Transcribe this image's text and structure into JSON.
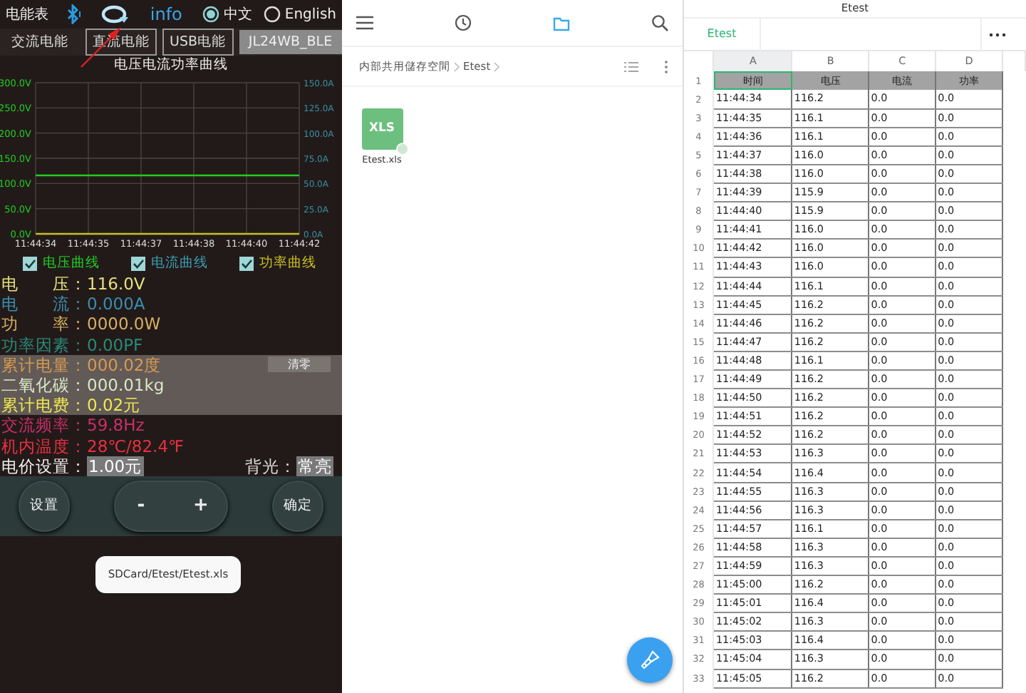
{
  "meter_app": {
    "title": "电能表",
    "info_label": "info",
    "languages": [
      {
        "label": "中文",
        "selected": true
      },
      {
        "label": "English",
        "selected": false
      }
    ],
    "tabs": [
      {
        "label": "交流电能",
        "selected": true
      },
      {
        "label": "直流电能",
        "selected": false
      },
      {
        "label": "USB电能",
        "selected": false
      }
    ],
    "device_name": "JL24WB_BLE",
    "chart": {
      "right_axis_labels": [
        "150.0A",
        "125.0A",
        "100.0A",
        "75.0A",
        "50.0A",
        "25.0A",
        "0.0A"
      ],
      "chart_data": {
        "type": "line",
        "title": "电压电流功率曲线",
        "grid": true,
        "categories": [
          "11:44:34",
          "11:44:35",
          "11:44:37",
          "11:44:38",
          "11:44:40",
          "11:44:42"
        ],
        "ylim": [
          0,
          300
        ],
        "yticks": [
          {
            "value": 0,
            "label": "0.0V"
          },
          {
            "value": 50,
            "label": "50.0V"
          },
          {
            "value": 100,
            "label": "100.0V"
          },
          {
            "value": 150,
            "label": "150.0V"
          },
          {
            "value": 200,
            "label": "200.0V"
          },
          {
            "value": 250,
            "label": "250.0V"
          },
          {
            "value": 300,
            "label": "300.0V"
          }
        ],
        "series": [
          {
            "name": "电压曲线",
            "color": "#22cc22",
            "values": [
              116,
              116,
              116,
              116,
              116,
              116
            ]
          },
          {
            "name": "电流曲线",
            "color": "#3a9fb0",
            "values": [
              null,
              null,
              null,
              null,
              null,
              null
            ]
          },
          {
            "name": "功率曲线",
            "color": "#c8c020",
            "values": [
              0,
              0,
              0,
              0,
              0,
              0
            ]
          }
        ]
      }
    },
    "legend": [
      {
        "checked": true
      },
      {
        "checked": true
      },
      {
        "checked": true
      }
    ],
    "readings": [
      {
        "label": "电　　压：",
        "value": "116.0V",
        "color": "#e6e07a",
        "highlighted": false
      },
      {
        "label": "电　　流：",
        "value": "0.000A",
        "color": "#3a8fb0",
        "highlighted": false
      },
      {
        "label": "功　　率：",
        "value": "0000.0W",
        "color": "#d8b060",
        "highlighted": false
      },
      {
        "label": "功率因素：",
        "value": "0.00PF",
        "color": "#2a8a78",
        "highlighted": false
      },
      {
        "label": "累计电量：",
        "value": "000.02度",
        "color": "#d89a50",
        "highlighted": true,
        "button": "清零"
      },
      {
        "label": "二氧化碳：",
        "value": "000.01kg",
        "color": "#d8e8c8",
        "highlighted": true
      },
      {
        "label": "累计电费：",
        "value": "0.02元",
        "color": "#f0e850",
        "highlighted": true
      },
      {
        "label": "交流频率：",
        "value": "59.8Hz",
        "color": "#c8306a",
        "highlighted": false
      },
      {
        "label": "机内温度：",
        "value": "28℃/82.4℉",
        "color": "#e83040",
        "highlighted": false
      }
    ],
    "price_setting": {
      "label": "电价设置：",
      "value": "1.00元"
    },
    "backlight": {
      "label": "背光：",
      "value": "常亮"
    },
    "controls": {
      "settings": "设置",
      "minus": "-",
      "plus": "+",
      "confirm": "确定"
    },
    "toast": "SDCard/Etest/Etest.xls"
  },
  "file_manager": {
    "nav": [
      {
        "kind": "menu",
        "selected": false
      },
      {
        "kind": "recent",
        "selected": false
      },
      {
        "kind": "folder",
        "selected": true
      },
      {
        "kind": "search",
        "selected": false
      }
    ],
    "breadcrumb": [
      "内部共用儲存空間",
      "Etest"
    ],
    "files": [
      {
        "type_label": "XLS",
        "name": "Etest.xls"
      }
    ]
  },
  "spreadsheet": {
    "title": "Etest",
    "sheet_tab": "Etest",
    "columns": [
      {
        "label": "A",
        "selected": true
      },
      {
        "label": "B",
        "selected": false
      },
      {
        "label": "C",
        "selected": false
      },
      {
        "label": "D",
        "selected": false
      }
    ],
    "rows": [
      {
        "number": "1",
        "kind": "header",
        "selected": true,
        "cells": [
          "时间",
          "电压",
          "电流",
          "功率"
        ]
      },
      {
        "number": "2",
        "kind": "data",
        "selected": false,
        "cells": [
          "11:44:34",
          "116.2",
          "0.0",
          "0.0"
        ]
      },
      {
        "number": "3",
        "kind": "data",
        "selected": false,
        "cells": [
          "11:44:35",
          "116.1",
          "0.0",
          "0.0"
        ]
      },
      {
        "number": "4",
        "kind": "data",
        "selected": false,
        "cells": [
          "11:44:36",
          "116.1",
          "0.0",
          "0.0"
        ]
      },
      {
        "number": "5",
        "kind": "data",
        "selected": false,
        "cells": [
          "11:44:37",
          "116.0",
          "0.0",
          "0.0"
        ]
      },
      {
        "number": "6",
        "kind": "data",
        "selected": false,
        "cells": [
          "11:44:38",
          "116.0",
          "0.0",
          "0.0"
        ]
      },
      {
        "number": "7",
        "kind": "data",
        "selected": false,
        "cells": [
          "11:44:39",
          "115.9",
          "0.0",
          "0.0"
        ]
      },
      {
        "number": "8",
        "kind": "data",
        "selected": false,
        "cells": [
          "11:44:40",
          "115.9",
          "0.0",
          "0.0"
        ]
      },
      {
        "number": "9",
        "kind": "data",
        "selected": false,
        "cells": [
          "11:44:41",
          "116.0",
          "0.0",
          "0.0"
        ]
      },
      {
        "number": "10",
        "kind": "data",
        "selected": false,
        "cells": [
          "11:44:42",
          "116.0",
          "0.0",
          "0.0"
        ]
      },
      {
        "number": "11",
        "kind": "data",
        "selected": false,
        "cells": [
          "11:44:43",
          "116.0",
          "0.0",
          "0.0"
        ]
      },
      {
        "number": "12",
        "kind": "data",
        "selected": false,
        "cells": [
          "11:44:44",
          "116.1",
          "0.0",
          "0.0"
        ]
      },
      {
        "number": "13",
        "kind": "data",
        "selected": false,
        "cells": [
          "11:44:45",
          "116.2",
          "0.0",
          "0.0"
        ]
      },
      {
        "number": "14",
        "kind": "data",
        "selected": false,
        "cells": [
          "11:44:46",
          "116.2",
          "0.0",
          "0.0"
        ]
      },
      {
        "number": "15",
        "kind": "data",
        "selected": false,
        "cells": [
          "11:44:47",
          "116.2",
          "0.0",
          "0.0"
        ]
      },
      {
        "number": "16",
        "kind": "data",
        "selected": false,
        "cells": [
          "11:44:48",
          "116.1",
          "0.0",
          "0.0"
        ]
      },
      {
        "number": "17",
        "kind": "data",
        "selected": false,
        "cells": [
          "11:44:49",
          "116.2",
          "0.0",
          "0.0"
        ]
      },
      {
        "number": "18",
        "kind": "data",
        "selected": false,
        "cells": [
          "11:44:50",
          "116.2",
          "0.0",
          "0.0"
        ]
      },
      {
        "number": "19",
        "kind": "data",
        "selected": false,
        "cells": [
          "11:44:51",
          "116.2",
          "0.0",
          "0.0"
        ]
      },
      {
        "number": "20",
        "kind": "data",
        "selected": false,
        "cells": [
          "11:44:52",
          "116.2",
          "0.0",
          "0.0"
        ]
      },
      {
        "number": "21",
        "kind": "data",
        "selected": false,
        "cells": [
          "11:44:53",
          "116.3",
          "0.0",
          "0.0"
        ]
      },
      {
        "number": "22",
        "kind": "data",
        "selected": false,
        "cells": [
          "11:44:54",
          "116.4",
          "0.0",
          "0.0"
        ]
      },
      {
        "number": "23",
        "kind": "data",
        "selected": false,
        "cells": [
          "11:44:55",
          "116.3",
          "0.0",
          "0.0"
        ]
      },
      {
        "number": "24",
        "kind": "data",
        "selected": false,
        "cells": [
          "11:44:56",
          "116.3",
          "0.0",
          "0.0"
        ]
      },
      {
        "number": "25",
        "kind": "data",
        "selected": false,
        "cells": [
          "11:44:57",
          "116.1",
          "0.0",
          "0.0"
        ]
      },
      {
        "number": "26",
        "kind": "data",
        "selected": false,
        "cells": [
          "11:44:58",
          "116.3",
          "0.0",
          "0.0"
        ]
      },
      {
        "number": "27",
        "kind": "data",
        "selected": false,
        "cells": [
          "11:44:59",
          "116.3",
          "0.0",
          "0.0"
        ]
      },
      {
        "number": "28",
        "kind": "data",
        "selected": false,
        "cells": [
          "11:45:00",
          "116.2",
          "0.0",
          "0.0"
        ]
      },
      {
        "number": "29",
        "kind": "data",
        "selected": false,
        "cells": [
          "11:45:01",
          "116.4",
          "0.0",
          "0.0"
        ]
      },
      {
        "number": "30",
        "kind": "data",
        "selected": false,
        "cells": [
          "11:45:02",
          "116.3",
          "0.0",
          "0.0"
        ]
      },
      {
        "number": "31",
        "kind": "data",
        "selected": false,
        "cells": [
          "11:45:03",
          "116.4",
          "0.0",
          "0.0"
        ]
      },
      {
        "number": "32",
        "kind": "data",
        "selected": false,
        "cells": [
          "11:45:04",
          "116.3",
          "0.0",
          "0.0"
        ]
      },
      {
        "number": "33",
        "kind": "data",
        "selected": false,
        "cells": [
          "11:45:05",
          "116.2",
          "0.0",
          "0.0"
        ]
      }
    ]
  }
}
